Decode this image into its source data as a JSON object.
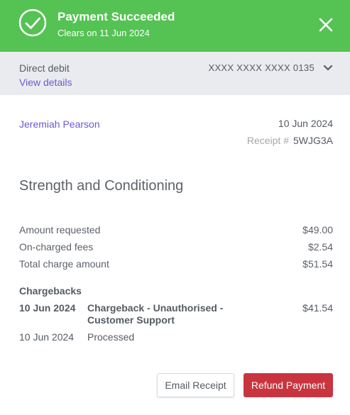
{
  "header": {
    "title": "Payment Succeeded",
    "subtitle": "Clears on 11 Jun 2024",
    "color": "#55c254",
    "icons": {
      "status": "check-circle-icon",
      "close": "close-icon"
    }
  },
  "payment_method": {
    "label": "Direct debit",
    "details_link": "View details",
    "masked_number": "XXXX XXXX XXXX 0135",
    "expand_icon": "chevron-down-icon"
  },
  "payer": {
    "name": "Jeremiah Pearson",
    "date": "10 Jun 2024",
    "receipt_label": "Receipt #",
    "receipt_number": "5WJG3A"
  },
  "item": {
    "title": "Strength and Conditioning"
  },
  "amounts": [
    {
      "label": "Amount requested",
      "value": "$49.00"
    },
    {
      "label": "On-charged fees",
      "value": "$2.54"
    },
    {
      "label": "Total charge amount",
      "value": "$51.54"
    }
  ],
  "chargebacks": {
    "title": "Chargebacks",
    "entries": [
      {
        "date": "10 Jun 2024",
        "description": "Chargeback - Unauthorised - Customer Support",
        "amount": "$41.54"
      },
      {
        "date": "10 Jun 2024",
        "description": "Processed",
        "amount": ""
      }
    ]
  },
  "actions": {
    "email_receipt": "Email Receipt",
    "refund_payment": "Refund Payment",
    "refund_color": "#c9353f"
  }
}
